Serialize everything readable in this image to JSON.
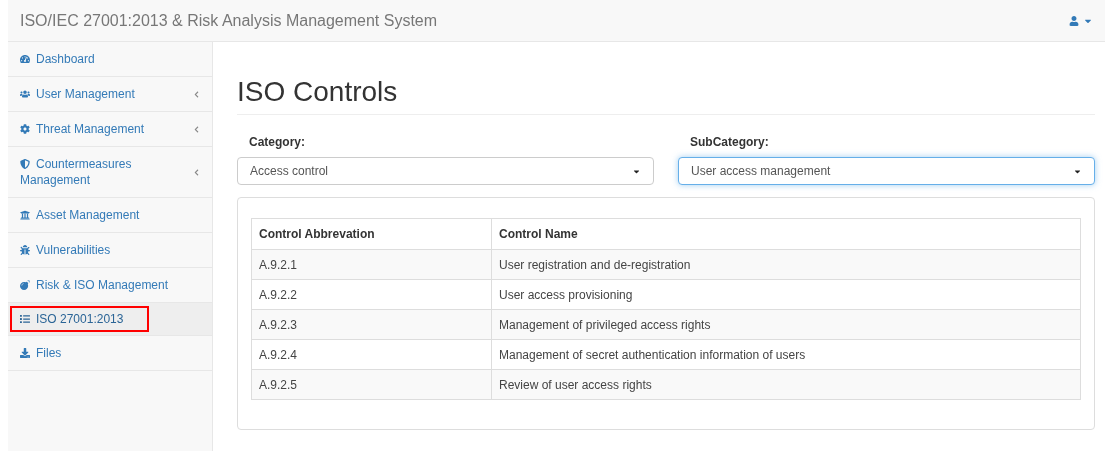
{
  "navbar": {
    "title": "ISO/IEC 27001:2013 & Risk Analysis Management System"
  },
  "sidebar": {
    "items": [
      {
        "label": "Dashboard",
        "expandable": false,
        "selected": false,
        "outlined": false
      },
      {
        "label": "User Management",
        "expandable": true,
        "selected": false,
        "outlined": false
      },
      {
        "label": "Threat Management",
        "expandable": true,
        "selected": false,
        "outlined": false
      },
      {
        "label": "Countermeasures Management",
        "expandable": true,
        "selected": false,
        "outlined": false
      },
      {
        "label": "Asset Management",
        "expandable": false,
        "selected": false,
        "outlined": false
      },
      {
        "label": "Vulnerabilities",
        "expandable": false,
        "selected": false,
        "outlined": false
      },
      {
        "label": "Risk & ISO Management",
        "expandable": false,
        "selected": false,
        "outlined": false
      },
      {
        "label": "ISO 27001:2013",
        "expandable": false,
        "selected": true,
        "outlined": true
      },
      {
        "label": "Files",
        "expandable": false,
        "selected": false,
        "outlined": false
      }
    ]
  },
  "page": {
    "title": "ISO Controls"
  },
  "filters": [
    {
      "label": "Category:",
      "value": "Access control",
      "focused": false
    },
    {
      "label": "SubCategory:",
      "value": "User access management",
      "focused": true
    }
  ],
  "table": {
    "columns": [
      "Control Abbrevation",
      "Control Name"
    ],
    "rows": [
      [
        "A.9.2.1",
        "User registration and de-registration"
      ],
      [
        "A.9.2.2",
        "User access provisioning"
      ],
      [
        "A.9.2.3",
        "Management of privileged access rights"
      ],
      [
        "A.9.2.4",
        "Management of secret authentication information of users"
      ],
      [
        "A.9.2.5",
        "Review of user access rights"
      ]
    ]
  }
}
